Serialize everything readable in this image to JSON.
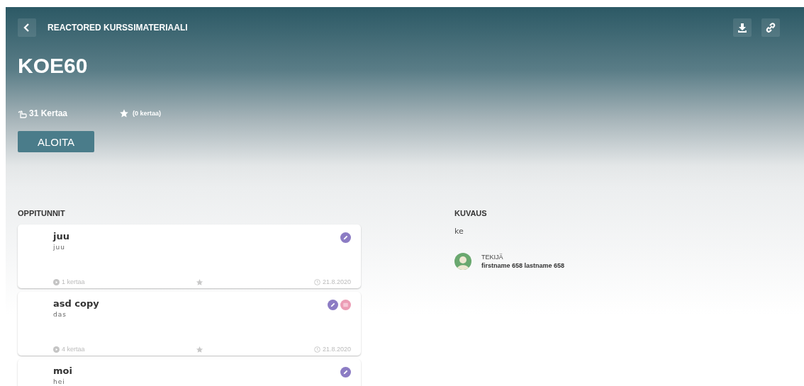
{
  "header": {
    "back_label": "REACTORED KURSSIMATERIAALI",
    "title": "KOE60",
    "views": "31 Kertaa",
    "rating": "(0 kertaa)",
    "start_button": "ALOITA"
  },
  "lessons": {
    "heading": "OPPITUNNIT",
    "items": [
      {
        "title": "juu",
        "description": "juu",
        "badges": [
          {
            "kind": "edit"
          }
        ],
        "plays": "1 kertaa",
        "date": "21.8.2020"
      },
      {
        "title": "asd copy",
        "description": "das",
        "badges": [
          {
            "kind": "edit"
          },
          {
            "kind": "copy"
          }
        ],
        "plays": "4 kertaa",
        "date": "21.8.2020"
      },
      {
        "title": "moi",
        "description": "hei",
        "badges": [
          {
            "kind": "edit"
          }
        ]
      }
    ]
  },
  "description": {
    "heading": "KUVAUS",
    "text": "ke",
    "author_label": "TEKIJÄ",
    "author_name": "firstname 658 lastname 658"
  }
}
